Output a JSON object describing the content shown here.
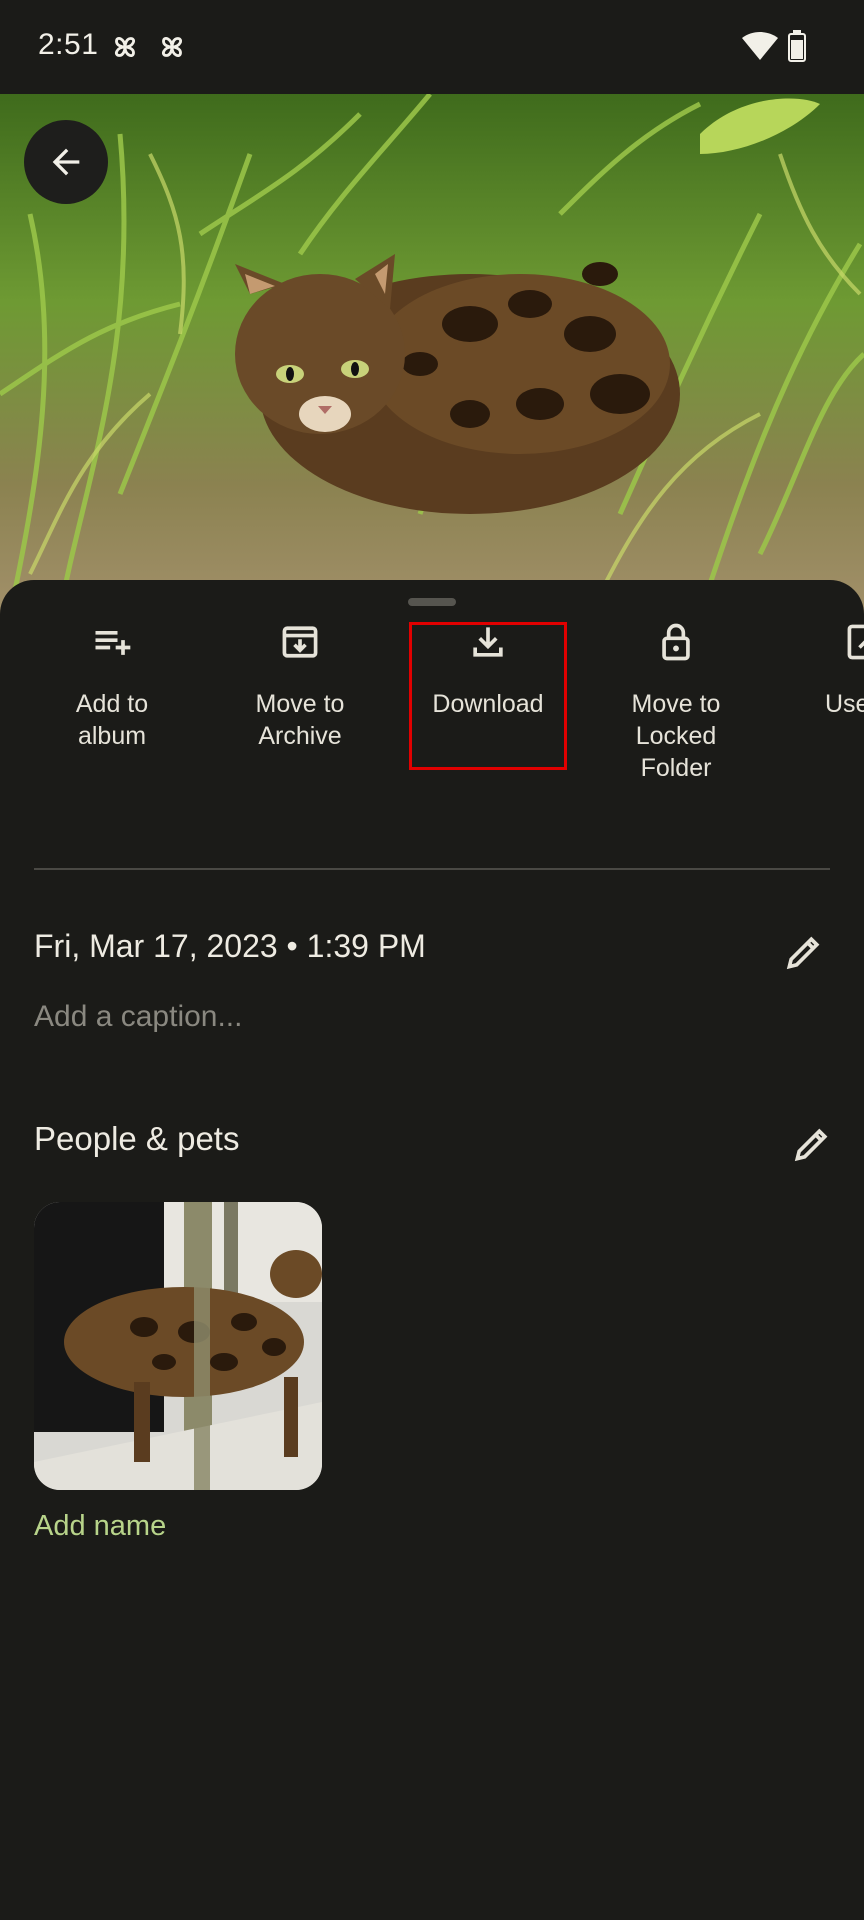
{
  "status_bar": {
    "time": "2:51",
    "notification_icons": [
      "pinwheel-icon",
      "pinwheel-icon"
    ],
    "wifi_icon": "wifi-icon",
    "battery_icon": "battery-icon"
  },
  "photo": {
    "description_icon": "cat-photo",
    "back_icon": "arrow-back-icon"
  },
  "actions": [
    {
      "label": "Add to\nalbum",
      "icon": "playlist-add-icon"
    },
    {
      "label": "Move to\nArchive",
      "icon": "archive-icon"
    },
    {
      "label": "Download",
      "icon": "download-icon"
    },
    {
      "label": "Move to\nLocked\nFolder",
      "icon": "lock-icon"
    },
    {
      "label": "Use",
      "icon": "edit-box-icon"
    }
  ],
  "details": {
    "date": "Fri, Mar 17, 2023  •  1:39 PM",
    "caption_placeholder": "Add a caption..."
  },
  "people": {
    "title": "People & pets",
    "add_name": "Add name"
  },
  "colors": {
    "background": "#1b1b18",
    "accent_green": "#b8d48a",
    "highlight": "#e10000"
  }
}
